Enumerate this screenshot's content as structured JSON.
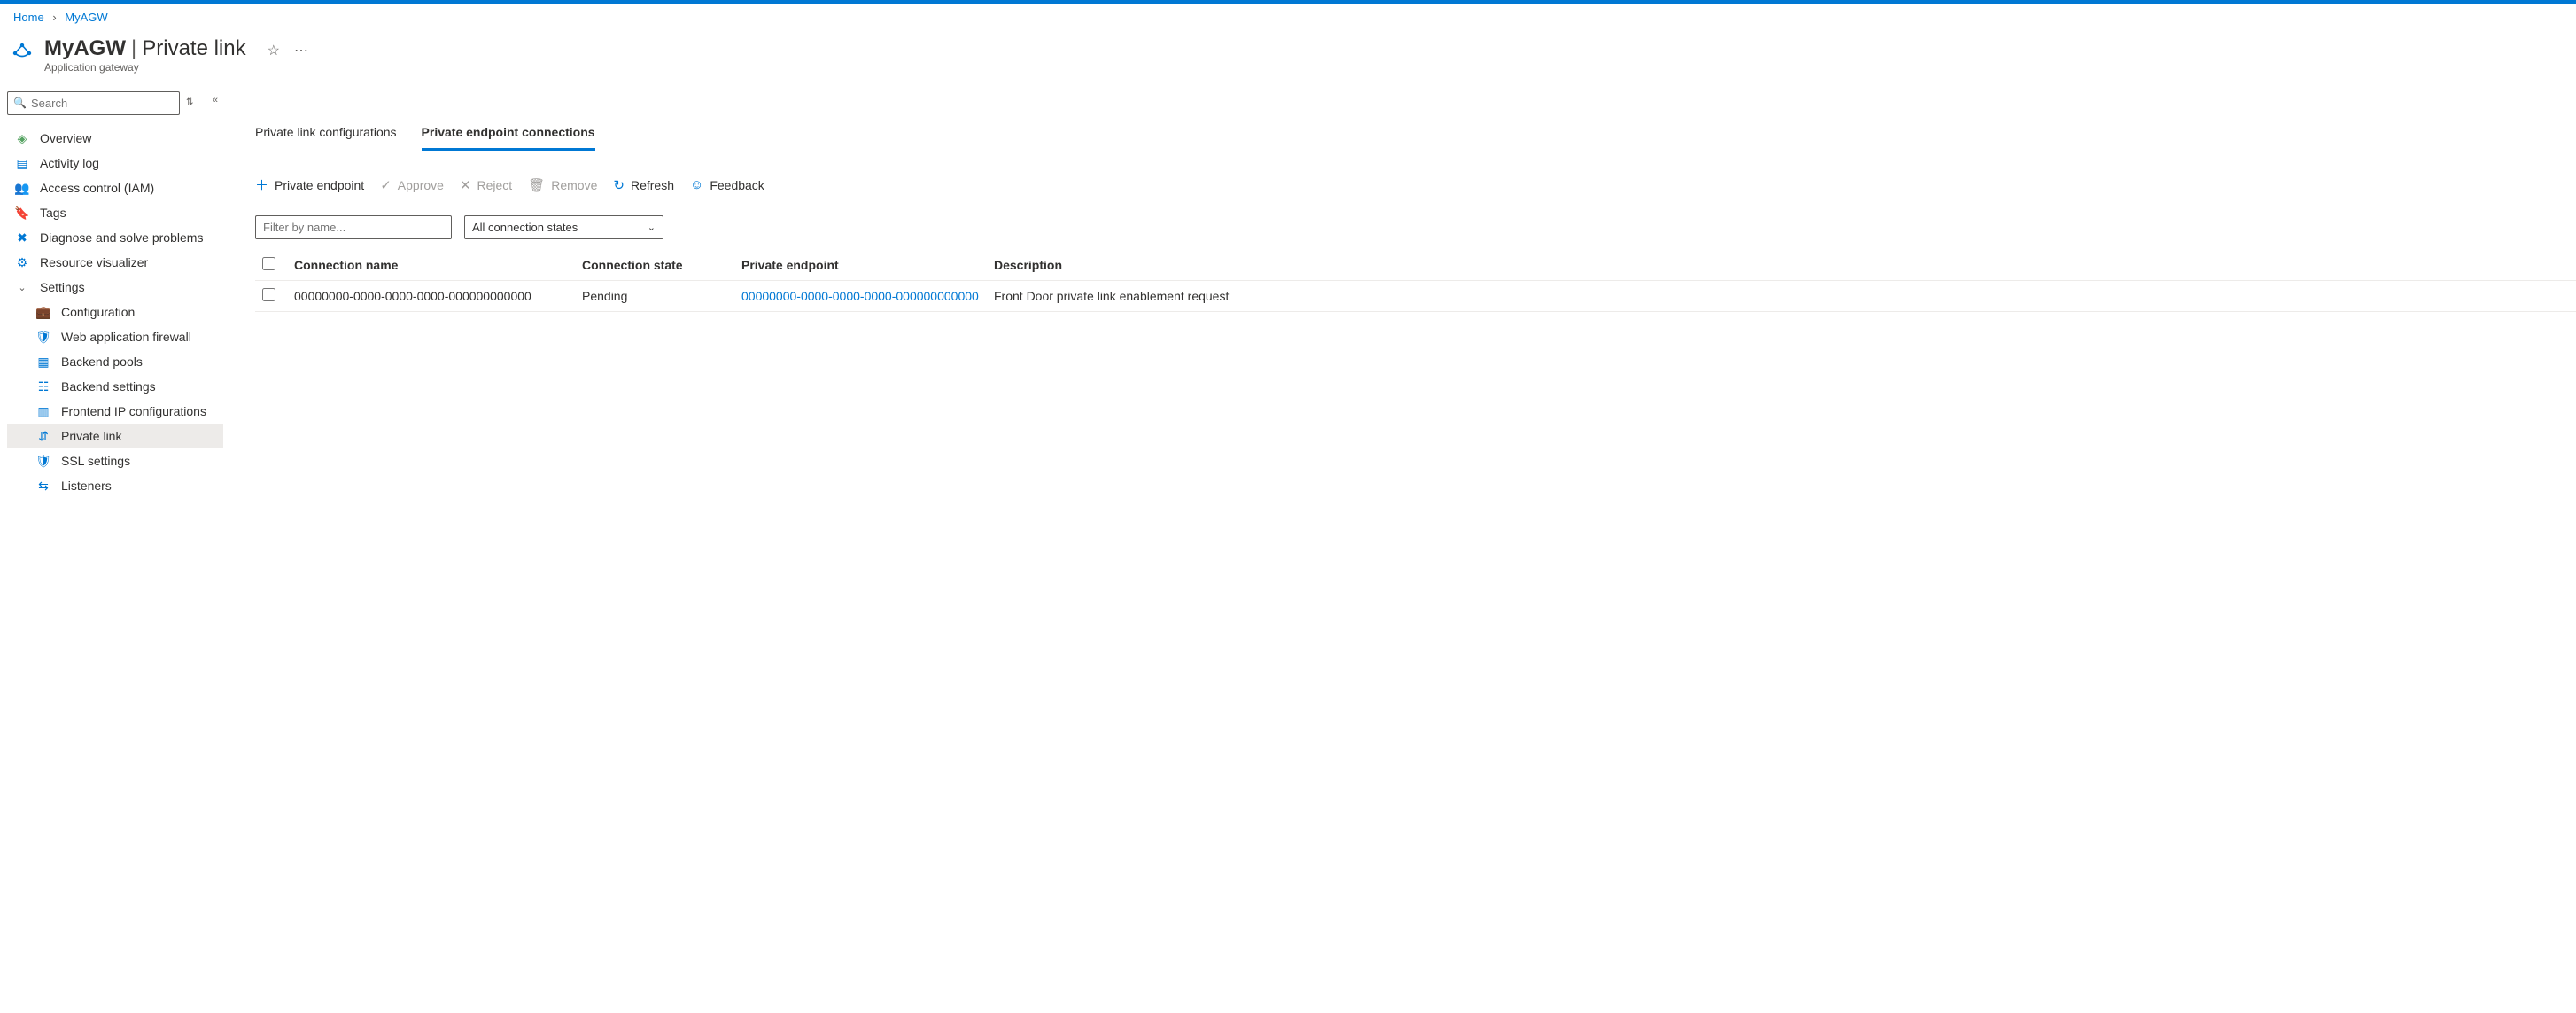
{
  "breadcrumb": {
    "home": "Home",
    "resource": "MyAGW"
  },
  "header": {
    "name": "MyAGW",
    "blade": "Private link",
    "type": "Application gateway"
  },
  "sidebar": {
    "search_placeholder": "Search",
    "overview": "Overview",
    "activity_log": "Activity log",
    "iam": "Access control (IAM)",
    "tags": "Tags",
    "diagnose": "Diagnose and solve problems",
    "visualizer": "Resource visualizer",
    "settings_section": "Settings",
    "configuration": "Configuration",
    "waf": "Web application firewall",
    "backend_pools": "Backend pools",
    "backend_settings": "Backend settings",
    "frontend_ip": "Frontend IP configurations",
    "private_link": "Private link",
    "ssl": "SSL settings",
    "listeners": "Listeners"
  },
  "tabs": {
    "configs": "Private link configurations",
    "connections": "Private endpoint connections"
  },
  "toolbar": {
    "add_pe": "Private endpoint",
    "approve": "Approve",
    "reject": "Reject",
    "remove": "Remove",
    "refresh": "Refresh",
    "feedback": "Feedback"
  },
  "filters": {
    "name_placeholder": "Filter by name...",
    "state_selected": "All connection states"
  },
  "table": {
    "headers": {
      "name": "Connection name",
      "state": "Connection state",
      "pe": "Private endpoint",
      "desc": "Description"
    },
    "rows": [
      {
        "name": "00000000-0000-0000-0000-000000000000",
        "state": "Pending",
        "pe": "00000000-0000-0000-0000-000000000000",
        "desc": "Front Door private link enablement request"
      }
    ]
  }
}
